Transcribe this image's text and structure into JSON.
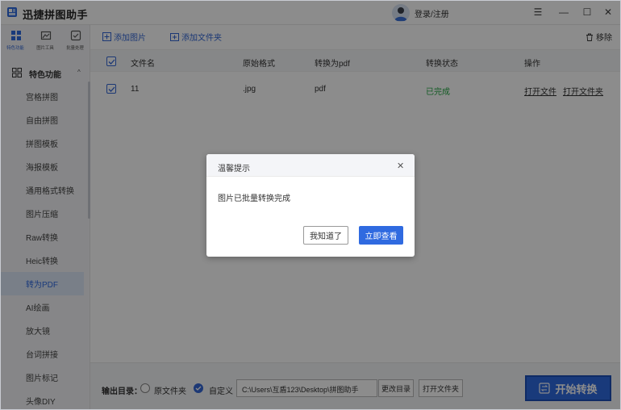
{
  "app": {
    "title": "迅捷拼图助手",
    "login": "登录/注册"
  },
  "window_controls": {
    "menu": "☰",
    "minimize": "—",
    "maximize": "☐",
    "close": "✕"
  },
  "sidebar": {
    "tabs": [
      {
        "label": "特色功能",
        "icon": "grid-icon"
      },
      {
        "label": "图片工具",
        "icon": "image-tool-icon"
      },
      {
        "label": "批量处理",
        "icon": "batch-icon"
      }
    ],
    "section": {
      "label": "特色功能",
      "chevron": "^"
    },
    "items": [
      "宫格拼图",
      "自由拼图",
      "拼图模板",
      "海报模板",
      "通用格式转换",
      "图片压缩",
      "Raw转换",
      "Heic转换",
      "转为PDF",
      "AI绘画",
      "放大镜",
      "台词拼接",
      "图片标记",
      "头像DIY"
    ],
    "active_index": 8
  },
  "toolbar": {
    "add_image": "添加图片",
    "add_folder": "添加文件夹",
    "remove": "移除"
  },
  "table": {
    "headers": [
      "文件名",
      "原始格式",
      "转换为pdf",
      "转换状态",
      "操作"
    ],
    "rows": [
      {
        "name": "11",
        "format": ".jpg",
        "target": "pdf",
        "status": "已完成",
        "open_file": "打开文件",
        "open_folder": "打开文件夹"
      }
    ]
  },
  "footer": {
    "output_label": "输出目录：",
    "option_original": "原文件夹",
    "option_custom": "自定义",
    "path": "C:\\Users\\互盾123\\Desktop\\拼图助手",
    "change_dir": "更改目录",
    "open_folder": "打开文件夹",
    "start": "开始转换"
  },
  "dialog": {
    "title": "温馨提示",
    "close": "✕",
    "message": "图片已批量转换完成",
    "btn_ok": "我知道了",
    "btn_view": "立即查看"
  },
  "colors": {
    "accent": "#2f6ae0",
    "success": "#27a745"
  }
}
